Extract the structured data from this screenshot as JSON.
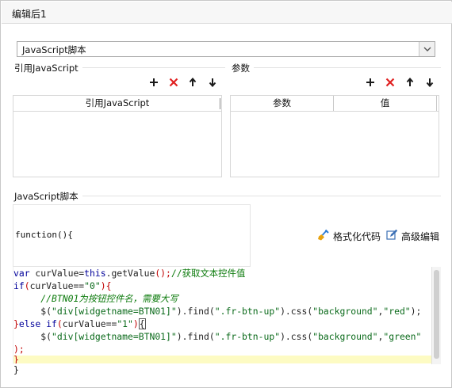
{
  "window": {
    "title": "编辑后1"
  },
  "type_select": {
    "value": "JavaScript脚本"
  },
  "ref_section": {
    "label": "引用JavaScript",
    "column": "引用JavaScript"
  },
  "param_section": {
    "label": "参数",
    "columns": [
      "参数",
      "值"
    ]
  },
  "toolbar_icons": [
    "plus-icon",
    "delete-icon",
    "arrow-up-icon",
    "arrow-down-icon"
  ],
  "script_section": {
    "label": "JavaScript脚本",
    "function_header": "function(){",
    "format_label": "格式化代码",
    "advanced_label": "高级编辑",
    "closing_brace": "}"
  },
  "code": {
    "line1": {
      "kw1": "var",
      "t1": " curValue=",
      "kw2": "this",
      "t2": ".getValue",
      "p": "();",
      "comment": "//获取文本控件值"
    },
    "line2": {
      "kw": "if",
      "open": "(",
      "t1": "curValue==",
      "s": "\"0\"",
      "close": "){"
    },
    "line3": {
      "indent": "     ",
      "comment": "//BTN01为按钮控件名，需要大写"
    },
    "line4": {
      "indent": "     ",
      "t1": "$(",
      "s1": "\"div[widgetname=BTN01]\"",
      "t2": ").find(",
      "s2": "\".fr-btn-up\"",
      "t3": ").css(",
      "s3": "\"background\"",
      "comma": ",",
      "s4": "\"red\"",
      "end": ");"
    },
    "line5": {
      "brace": "}",
      "kw1": "else",
      "sp": " ",
      "kw2": "if",
      "open": "(",
      "t1": "curValue==",
      "s": "\"1\"",
      "close": ")",
      "caret": "{"
    },
    "line6": {
      "indent": "     ",
      "t1": "$(",
      "s1": "\"div[widgetname=BTN01]\"",
      "t2": ").find(",
      "s2": "\".fr-btn-up\"",
      "t3": ").css(",
      "s3": "\"background\"",
      "comma": ",",
      "s4": "\"green\""
    },
    "line7": ");",
    "line8": "}"
  },
  "colors": {
    "add": "#1a1a1a",
    "delete": "#e02020",
    "keyword": "#00009a",
    "string": "#0a6a1a",
    "comment": "#0b7a0b",
    "current_line": "#fdfbc3"
  }
}
